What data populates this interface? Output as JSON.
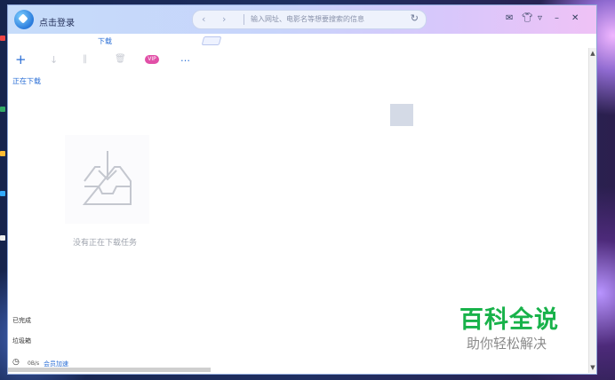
{
  "titlebar": {
    "login_text": "点击登录",
    "address_placeholder": "输入网址、电影名等想要搜索的信息"
  },
  "tabs": [
    {
      "label": "下载"
    }
  ],
  "sidebar": {
    "downloading": "正在下载",
    "completed": "已完成",
    "trash": "垃圾箱"
  },
  "toolbar": {
    "vip": "VIP"
  },
  "main": {
    "empty_message": "没有正在下载任务"
  },
  "status": {
    "speed": "0B/s",
    "accelerate": "会员加速"
  },
  "watermark": {
    "title": "百科全说",
    "subtitle": "助你轻松解决"
  },
  "colors": {
    "accent": "#2b6fd6",
    "vip": "#e14fa7",
    "watermark_green": "#18b24a"
  }
}
